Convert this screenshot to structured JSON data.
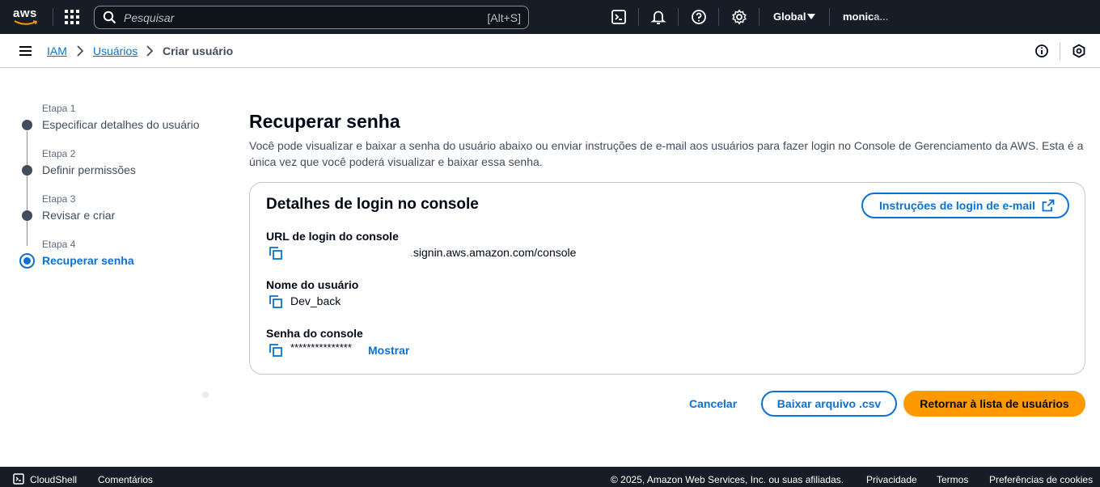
{
  "topnav": {
    "logo_text": "aws",
    "search_placeholder": "Pesquisar",
    "search_shortcut": "[Alt+S]",
    "region": "Global",
    "account": "monica..."
  },
  "breadcrumb": {
    "items": [
      "IAM",
      "Usuários",
      "Criar usuário"
    ]
  },
  "steps": [
    {
      "small": "Etapa 1",
      "label": "Especificar detalhes do usuário",
      "active": false
    },
    {
      "small": "Etapa 2",
      "label": "Definir permissões",
      "active": false
    },
    {
      "small": "Etapa 3",
      "label": "Revisar e criar",
      "active": false
    },
    {
      "small": "Etapa 4",
      "label": "Recuperar senha",
      "active": true
    }
  ],
  "main": {
    "title": "Recuperar senha",
    "description": "Você pode visualizar e baixar a senha do usuário abaixo ou enviar instruções de e-mail aos usuários para fazer login no Console de Gerenciamento da AWS. Esta é a única vez que você poderá visualizar e baixar essa senha.",
    "card": {
      "title": "Detalhes de login no console",
      "email_button": "Instruções de login de e-mail",
      "fields": [
        {
          "label": "URL de login do console",
          "value": ".signin.aws.amazon.com/console"
        },
        {
          "label": "Nome do usuário",
          "value": "Dev_back"
        },
        {
          "label": "Senha do console",
          "value": "***************"
        }
      ],
      "show_link": "Mostrar"
    }
  },
  "actions": {
    "cancel": "Cancelar",
    "download_csv": "Baixar arquivo .csv",
    "return": "Retornar à lista de usuários"
  },
  "footer": {
    "cloudshell": "CloudShell",
    "comments": "Comentários",
    "copyright": "© 2025, Amazon Web Services, Inc. ou suas afiliadas.",
    "privacy": "Privacidade",
    "terms": "Termos",
    "cookies": "Preferências de cookies"
  },
  "colors": {
    "nav_bg": "#161d26",
    "link": "#0972d3",
    "primary_button": "#ff9900"
  }
}
